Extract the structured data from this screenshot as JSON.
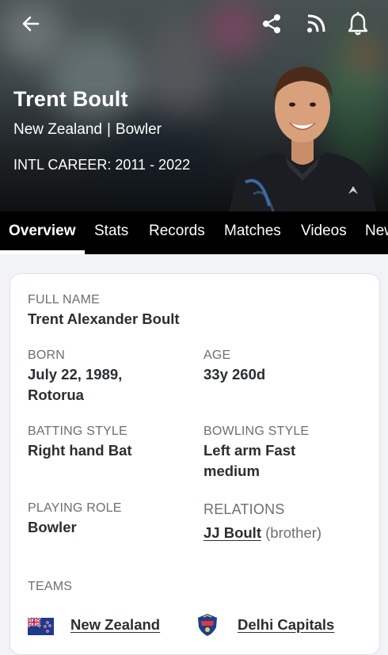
{
  "header": {
    "name": "Trent Boult",
    "country": "New Zealand",
    "separator": "|",
    "role": "Bowler",
    "career": "INTL CAREER: 2011 - 2022",
    "icons": [
      "back-arrow-icon",
      "share-icon",
      "rss-feed-icon",
      "bell-icon"
    ]
  },
  "tabs": [
    "Overview",
    "Stats",
    "Records",
    "Matches",
    "Videos",
    "News"
  ],
  "active_tab": "Overview",
  "profile": {
    "full_name_label": "FULL NAME",
    "full_name": "Trent Alexander Boult",
    "born_label": "BORN",
    "born_line1": "July 22, 1989,",
    "born_line2": "Rotorua",
    "age_label": "AGE",
    "age": "33y 260d",
    "batting_label": "BATTING STYLE",
    "batting": "Right hand Bat",
    "bowling_label": "BOWLING STYLE",
    "bowling_line1": "Left arm Fast",
    "bowling_line2": "medium",
    "role_label": "PLAYING ROLE",
    "role": "Bowler",
    "relations_label": "RELATIONS",
    "relation_name": "JJ Boult",
    "relation_type": "(brother)",
    "teams_label": "TEAMS",
    "teams": [
      "New Zealand",
      "Delhi Capitals"
    ]
  },
  "colors": {
    "accent": "#000000",
    "text": "#2b2e31",
    "muted": "#6b6f73",
    "background": "#f2f3f6"
  }
}
